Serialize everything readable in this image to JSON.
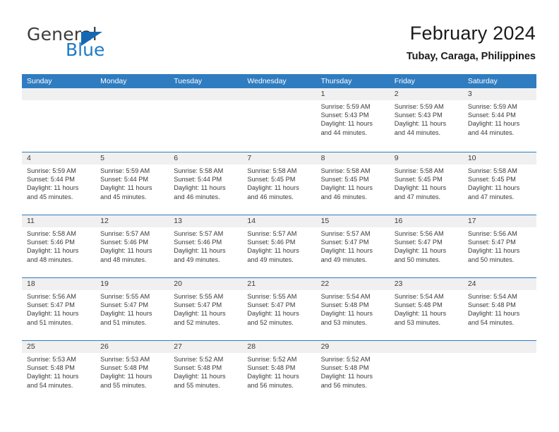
{
  "brand": {
    "name_top": "General",
    "name_bottom": "Blue",
    "accent_color": "#1668b3"
  },
  "header": {
    "title": "February 2024",
    "location": "Tubay, Caraga, Philippines"
  },
  "theme": {
    "header_bar": "#2f7cc0",
    "daynum_bg": "#f0f0f0",
    "text": "#3a3a3a"
  },
  "calendar": {
    "weekday_headers": [
      "Sunday",
      "Monday",
      "Tuesday",
      "Wednesday",
      "Thursday",
      "Friday",
      "Saturday"
    ],
    "weeks": [
      [
        {
          "day": "",
          "lines": []
        },
        {
          "day": "",
          "lines": []
        },
        {
          "day": "",
          "lines": []
        },
        {
          "day": "",
          "lines": []
        },
        {
          "day": "1",
          "lines": [
            "Sunrise: 5:59 AM",
            "Sunset: 5:43 PM",
            "Daylight: 11 hours",
            "and 44 minutes."
          ]
        },
        {
          "day": "2",
          "lines": [
            "Sunrise: 5:59 AM",
            "Sunset: 5:43 PM",
            "Daylight: 11 hours",
            "and 44 minutes."
          ]
        },
        {
          "day": "3",
          "lines": [
            "Sunrise: 5:59 AM",
            "Sunset: 5:44 PM",
            "Daylight: 11 hours",
            "and 44 minutes."
          ]
        }
      ],
      [
        {
          "day": "4",
          "lines": [
            "Sunrise: 5:59 AM",
            "Sunset: 5:44 PM",
            "Daylight: 11 hours",
            "and 45 minutes."
          ]
        },
        {
          "day": "5",
          "lines": [
            "Sunrise: 5:59 AM",
            "Sunset: 5:44 PM",
            "Daylight: 11 hours",
            "and 45 minutes."
          ]
        },
        {
          "day": "6",
          "lines": [
            "Sunrise: 5:58 AM",
            "Sunset: 5:44 PM",
            "Daylight: 11 hours",
            "and 46 minutes."
          ]
        },
        {
          "day": "7",
          "lines": [
            "Sunrise: 5:58 AM",
            "Sunset: 5:45 PM",
            "Daylight: 11 hours",
            "and 46 minutes."
          ]
        },
        {
          "day": "8",
          "lines": [
            "Sunrise: 5:58 AM",
            "Sunset: 5:45 PM",
            "Daylight: 11 hours",
            "and 46 minutes."
          ]
        },
        {
          "day": "9",
          "lines": [
            "Sunrise: 5:58 AM",
            "Sunset: 5:45 PM",
            "Daylight: 11 hours",
            "and 47 minutes."
          ]
        },
        {
          "day": "10",
          "lines": [
            "Sunrise: 5:58 AM",
            "Sunset: 5:45 PM",
            "Daylight: 11 hours",
            "and 47 minutes."
          ]
        }
      ],
      [
        {
          "day": "11",
          "lines": [
            "Sunrise: 5:58 AM",
            "Sunset: 5:46 PM",
            "Daylight: 11 hours",
            "and 48 minutes."
          ]
        },
        {
          "day": "12",
          "lines": [
            "Sunrise: 5:57 AM",
            "Sunset: 5:46 PM",
            "Daylight: 11 hours",
            "and 48 minutes."
          ]
        },
        {
          "day": "13",
          "lines": [
            "Sunrise: 5:57 AM",
            "Sunset: 5:46 PM",
            "Daylight: 11 hours",
            "and 49 minutes."
          ]
        },
        {
          "day": "14",
          "lines": [
            "Sunrise: 5:57 AM",
            "Sunset: 5:46 PM",
            "Daylight: 11 hours",
            "and 49 minutes."
          ]
        },
        {
          "day": "15",
          "lines": [
            "Sunrise: 5:57 AM",
            "Sunset: 5:47 PM",
            "Daylight: 11 hours",
            "and 49 minutes."
          ]
        },
        {
          "day": "16",
          "lines": [
            "Sunrise: 5:56 AM",
            "Sunset: 5:47 PM",
            "Daylight: 11 hours",
            "and 50 minutes."
          ]
        },
        {
          "day": "17",
          "lines": [
            "Sunrise: 5:56 AM",
            "Sunset: 5:47 PM",
            "Daylight: 11 hours",
            "and 50 minutes."
          ]
        }
      ],
      [
        {
          "day": "18",
          "lines": [
            "Sunrise: 5:56 AM",
            "Sunset: 5:47 PM",
            "Daylight: 11 hours",
            "and 51 minutes."
          ]
        },
        {
          "day": "19",
          "lines": [
            "Sunrise: 5:55 AM",
            "Sunset: 5:47 PM",
            "Daylight: 11 hours",
            "and 51 minutes."
          ]
        },
        {
          "day": "20",
          "lines": [
            "Sunrise: 5:55 AM",
            "Sunset: 5:47 PM",
            "Daylight: 11 hours",
            "and 52 minutes."
          ]
        },
        {
          "day": "21",
          "lines": [
            "Sunrise: 5:55 AM",
            "Sunset: 5:47 PM",
            "Daylight: 11 hours",
            "and 52 minutes."
          ]
        },
        {
          "day": "22",
          "lines": [
            "Sunrise: 5:54 AM",
            "Sunset: 5:48 PM",
            "Daylight: 11 hours",
            "and 53 minutes."
          ]
        },
        {
          "day": "23",
          "lines": [
            "Sunrise: 5:54 AM",
            "Sunset: 5:48 PM",
            "Daylight: 11 hours",
            "and 53 minutes."
          ]
        },
        {
          "day": "24",
          "lines": [
            "Sunrise: 5:54 AM",
            "Sunset: 5:48 PM",
            "Daylight: 11 hours",
            "and 54 minutes."
          ]
        }
      ],
      [
        {
          "day": "25",
          "lines": [
            "Sunrise: 5:53 AM",
            "Sunset: 5:48 PM",
            "Daylight: 11 hours",
            "and 54 minutes."
          ]
        },
        {
          "day": "26",
          "lines": [
            "Sunrise: 5:53 AM",
            "Sunset: 5:48 PM",
            "Daylight: 11 hours",
            "and 55 minutes."
          ]
        },
        {
          "day": "27",
          "lines": [
            "Sunrise: 5:52 AM",
            "Sunset: 5:48 PM",
            "Daylight: 11 hours",
            "and 55 minutes."
          ]
        },
        {
          "day": "28",
          "lines": [
            "Sunrise: 5:52 AM",
            "Sunset: 5:48 PM",
            "Daylight: 11 hours",
            "and 56 minutes."
          ]
        },
        {
          "day": "29",
          "lines": [
            "Sunrise: 5:52 AM",
            "Sunset: 5:48 PM",
            "Daylight: 11 hours",
            "and 56 minutes."
          ]
        },
        {
          "day": "",
          "lines": []
        },
        {
          "day": "",
          "lines": []
        }
      ]
    ]
  }
}
